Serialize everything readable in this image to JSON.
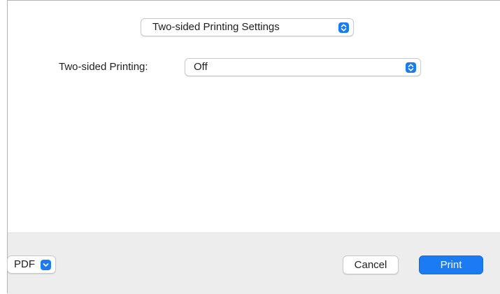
{
  "panel_selector": {
    "selected": "Two-sided Printing Settings"
  },
  "duplex": {
    "label": "Two-sided Printing:",
    "value": "Off"
  },
  "footer": {
    "pdf_label": "PDF",
    "cancel_label": "Cancel",
    "print_label": "Print"
  },
  "colors": {
    "accent": "#1a7bf2",
    "footer_background": "#ededed",
    "body_background": "#ffffff"
  },
  "icons": {
    "popup_stepper": "up-down-chevron-icon",
    "pdf_menu": "chevron-down-icon"
  }
}
